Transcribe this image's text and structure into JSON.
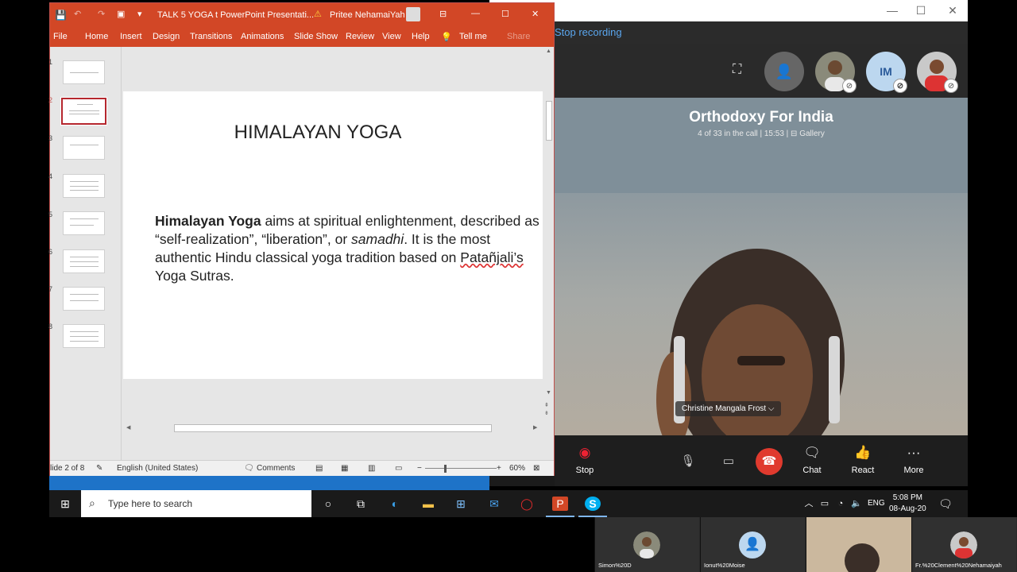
{
  "skype": {
    "stop_recording": "Stop recording",
    "avatar_initials": "IM",
    "caller_name": "Orthodoxy For India",
    "caller_meta": "4 of 33 in the call | 15:53 | ⊟ Gallery",
    "person_label": "Christine Mangala Frost ⌵",
    "buttons": {
      "stop": "Stop",
      "chat": "Chat",
      "react": "React",
      "more": "More"
    }
  },
  "ppt": {
    "title": "TALK 5 YOGA t PowerPoint Presentati...",
    "warning_user": "Pritee NehamaiYah",
    "share": "Share",
    "tabs": [
      "File",
      "Home",
      "Insert",
      "Design",
      "Transitions",
      "Animations",
      "Slide Show",
      "Review",
      "View",
      "Help",
      "Tell me"
    ],
    "slide_title": "HIMALAYAN YOGA",
    "slide_body_bold": "Himalayan Yoga",
    "slide_body_1": " aims at spiritual enlightenment, described as “self-realization”, “liberation”, or ",
    "slide_body_italic": "samadhi",
    "slide_body_2": ". It is the most authentic Hindu classical yoga tradition based on ",
    "slide_body_underlined": "Patañjali’s",
    "slide_body_3": " Yoga Sutras.",
    "thumb_numbers": [
      "1",
      "2",
      "3",
      "4",
      "5",
      "6",
      "7",
      "8"
    ],
    "status": {
      "slide": "lide 2 of 8",
      "language": "English (United States)",
      "comments": "Comments",
      "zoom": "60%"
    }
  },
  "taskbar": {
    "search_placeholder": "Type here to search",
    "lang": "ENG",
    "time": "5:08 PM",
    "date": "08-Aug-20"
  },
  "strip": {
    "tiles": [
      "Simon%20D",
      "Ionut%20Moise",
      "",
      "Fr.%20Clement%20Nehamaiyah"
    ]
  }
}
